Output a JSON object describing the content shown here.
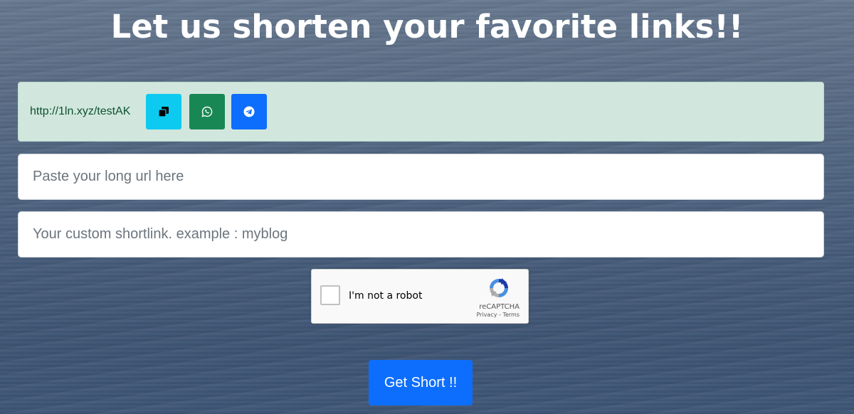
{
  "page": {
    "title": "Let us shorten your favorite links!!"
  },
  "result": {
    "short_url": "http://1ln.xyz/testAK",
    "buttons": [
      {
        "icon": "copy-icon",
        "color": "#0dcaf0"
      },
      {
        "icon": "whatsapp-icon",
        "color": "#198754"
      },
      {
        "icon": "telegram-icon",
        "color": "#0d6efd"
      }
    ]
  },
  "form": {
    "url_placeholder": "Paste your long url here",
    "url_value": "",
    "custom_placeholder": "Your custom shortlink. example : myblog",
    "custom_value": "",
    "submit_label": "Get Short !!"
  },
  "recaptcha": {
    "label": "I'm not a robot",
    "brand": "reCAPTCHA",
    "privacy": "Privacy",
    "separator": " - ",
    "terms": "Terms",
    "checked": false
  },
  "colors": {
    "success_bg": "#d1e7dd",
    "success_text": "#0f5132",
    "primary": "#0d6efd"
  }
}
